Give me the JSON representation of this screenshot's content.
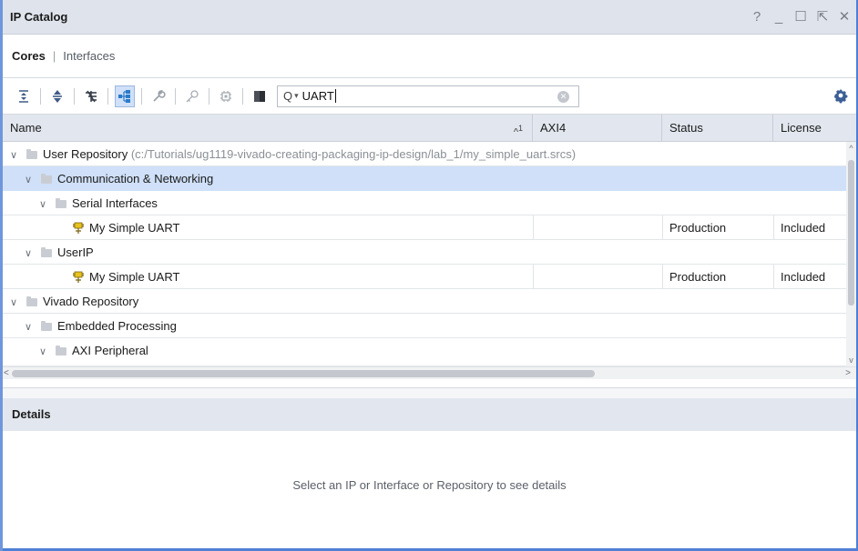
{
  "window": {
    "title": "IP Catalog",
    "controls": [
      "?",
      "_",
      "☐",
      "⇱",
      "✕"
    ]
  },
  "tabs": {
    "cores": "Cores",
    "separator": "|",
    "interfaces": "Interfaces"
  },
  "toolbar": {
    "buttons": [
      "collapse-all-icon",
      "expand-all-icon",
      "flatten-hierarchy-icon",
      "group-by-icon",
      "customize-ip-icon",
      "ip-settings-icon",
      "compatible-families-icon",
      "show-deprecated-icon"
    ],
    "search_prefix": "Q",
    "search_value": "UART"
  },
  "table": {
    "columns": {
      "name": "Name",
      "sort": "1",
      "axi4": "AXI4",
      "status": "Status",
      "license": "License"
    },
    "rows": [
      {
        "name": "User Repository",
        "path": "(c:/Tutorials/ug1119-vivado-creating-packaging-ip-design/lab_1/my_simple_uart.srcs)",
        "axi4": "",
        "status": "",
        "license": ""
      },
      {
        "name": "Communication & Networking",
        "path": "",
        "axi4": "",
        "status": "",
        "license": ""
      },
      {
        "name": "Serial Interfaces",
        "path": "",
        "axi4": "",
        "status": "",
        "license": ""
      },
      {
        "name": "My Simple UART",
        "path": "",
        "axi4": "",
        "status": "Production",
        "license": "Included"
      },
      {
        "name": "UserIP",
        "path": "",
        "axi4": "",
        "status": "",
        "license": ""
      },
      {
        "name": "My Simple UART",
        "path": "",
        "axi4": "",
        "status": "Production",
        "license": "Included"
      },
      {
        "name": "Vivado Repository",
        "path": "",
        "axi4": "",
        "status": "",
        "license": ""
      },
      {
        "name": "Embedded Processing",
        "path": "",
        "axi4": "",
        "status": "",
        "license": ""
      },
      {
        "name": "AXI Peripheral",
        "path": "",
        "axi4": "",
        "status": "",
        "license": ""
      }
    ]
  },
  "details": {
    "title": "Details",
    "message": "Select an IP or Interface or Repository to see details"
  }
}
